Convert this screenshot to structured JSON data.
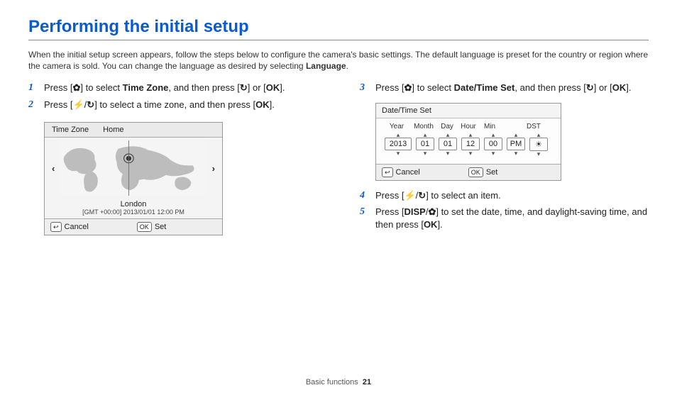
{
  "title": "Performing the initial setup",
  "intro_pre": "When the initial setup screen appears, follow the steps below to configure the camera's basic settings. The default language is preset for the country or region where the camera is sold. You can change the language as desired by selecting ",
  "intro_bold": "Language",
  "intro_post": ".",
  "icons": {
    "macro": "✿",
    "timer": "↻",
    "ok": "OK",
    "flash": "⚡",
    "disp": "DISP",
    "back": "↩",
    "dst": "☀"
  },
  "steps": {
    "s1": {
      "num": "1",
      "a": "Press [",
      "b": "] to select ",
      "bold": "Time Zone",
      "c": ", and then press [",
      "d": "] or [",
      "e": "]."
    },
    "s2": {
      "num": "2",
      "a": "Press [",
      "b": "/",
      "c": "] to select a time zone, and then press [",
      "d": "]."
    },
    "s3": {
      "num": "3",
      "a": "Press [",
      "b": "] to select ",
      "bold": "Date/Time Set",
      "c": ", and then press [",
      "d": "] or [",
      "e": "]."
    },
    "s4": {
      "num": "4",
      "a": "Press [",
      "b": "/",
      "c": "] to select an item."
    },
    "s5": {
      "num": "5",
      "a": "Press [",
      "b": "/",
      "c": "] to set the date, time, and daylight-saving time, and then press [",
      "d": "]."
    }
  },
  "tz_panel": {
    "tab1": "Time Zone",
    "tab2": "Home",
    "left": "‹",
    "right": "›",
    "city": "London",
    "gmt": "[GMT +00:00] 2013/01/01 12:00 PM",
    "cancel": "Cancel",
    "set": "Set",
    "back_key": "↩",
    "ok_key": "OK"
  },
  "dt_panel": {
    "title": "Date/Time Set",
    "labels": {
      "year": "Year",
      "month": "Month",
      "day": "Day",
      "hour": "Hour",
      "min": "Min",
      "dst": "DST"
    },
    "values": {
      "year": "2013",
      "month": "01",
      "day": "01",
      "hour": "12",
      "min": "00",
      "ampm": "PM"
    },
    "cancel": "Cancel",
    "set": "Set",
    "back_key": "↩",
    "ok_key": "OK"
  },
  "footer": {
    "section": "Basic functions",
    "page": "21"
  }
}
